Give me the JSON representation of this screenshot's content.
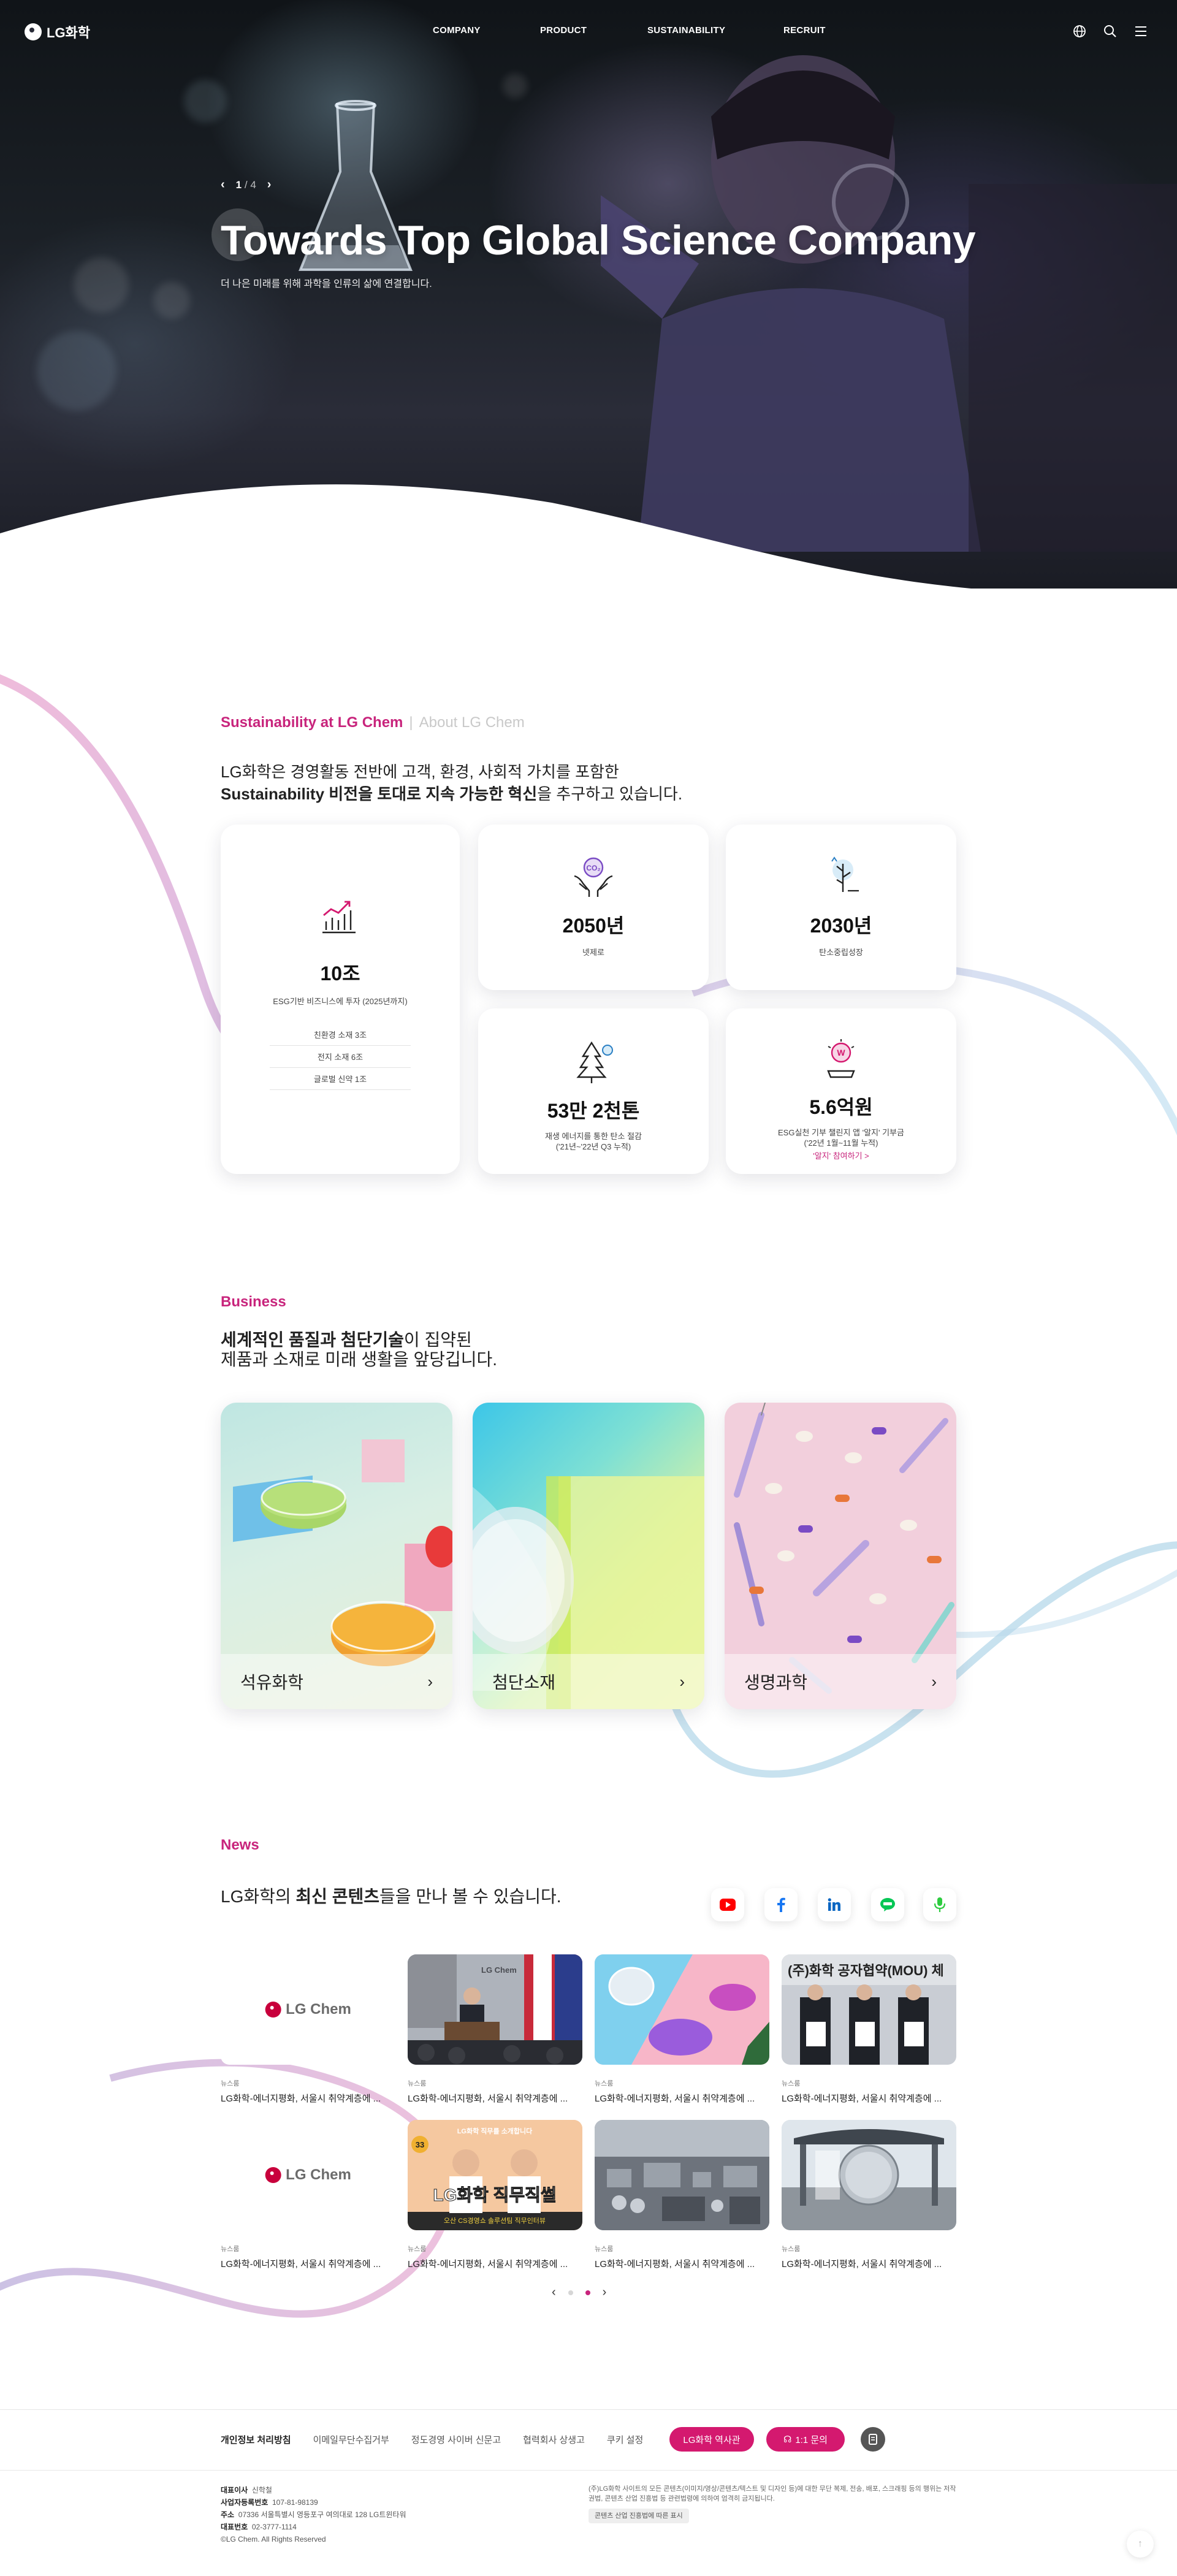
{
  "header": {
    "logo_text": "LG화학",
    "menu": [
      "COMPANY",
      "PRODUCT",
      "SUSTAINABILITY",
      "RECRUIT"
    ],
    "icons": [
      "globe-icon",
      "search-icon",
      "menu-icon"
    ]
  },
  "hero": {
    "pager_current": "1",
    "pager_total": "/ 4",
    "title": "Towards Top Global Science Company",
    "subtitle": "더 나은 미래를 위해 과학을 인류의 삶에 연결합니다."
  },
  "sustainability": {
    "eyebrow_active": "Sustainability at LG Chem",
    "eyebrow_inactive": "About LG Chem",
    "lead_line1": "LG화학은 경영활동 전반에 고객, 환경, 사회적 가치를 포함한",
    "lead_line2_bold": "Sustainability 비전을 토대로 지속 가능한 혁신",
    "lead_line2_rest": "을 추구하고 있습니다.",
    "cards": [
      {
        "icon": "growth-chart-icon",
        "num": "10조",
        "desc": "ESG기반 비즈니스에 투자 (2025년까지)",
        "list": [
          "친환경 소재 3조",
          "전지 소재 6조",
          "글로벌 신약 1조"
        ]
      },
      {
        "icon": "co2-hands-icon",
        "num": "2050년",
        "desc": "넷제로"
      },
      {
        "icon": "carbon-neutral-tree-icon",
        "num": "2030년",
        "desc": "탄소중립성장"
      },
      {
        "icon": "pine-tree-icon",
        "num": "53만 2천톤",
        "desc": "재생 에너지를 통한 탄소 절감",
        "desc2": "('21년~'22년 Q3 누적)"
      },
      {
        "icon": "donation-icon",
        "num": "5.6억원",
        "desc": "ESG실천 기부 챌린지 앱 '알지' 기부금",
        "desc2": "('22년 1월~11월 누적)",
        "link": "'알지' 참여하기 >"
      }
    ]
  },
  "business": {
    "eyebrow": "Business",
    "lead_bold": "세계적인 품질과 첨단기술",
    "lead_rest": "이 집약된",
    "lead_line2": "제품과 소재로 미래 생활을 앞당깁니다.",
    "cards": [
      {
        "label": "석유화학",
        "icon": "chevron-right-icon"
      },
      {
        "label": "첨단소재",
        "icon": "chevron-right-icon"
      },
      {
        "label": "생명과학",
        "icon": "chevron-right-icon"
      }
    ]
  },
  "news": {
    "eyebrow": "News",
    "lead_pre": "LG화학의 ",
    "lead_bold": "최신 콘텐츠",
    "lead_rest": "들을 만나 볼 수 있습니다.",
    "social": [
      {
        "name": "youtube-icon",
        "color": "#ff0000"
      },
      {
        "name": "facebook-icon",
        "color": "#1877f2"
      },
      {
        "name": "linkedin-icon",
        "color": "#0a66c2"
      },
      {
        "name": "line-icon",
        "color": "#06c755"
      },
      {
        "name": "podcast-icon",
        "color": "#2ecc40"
      }
    ],
    "logo_text": "LG Chem",
    "items": [
      {
        "cat": "뉴스룸",
        "title": "LG화학-에너지평화, 서울시 취약계층에 ..."
      },
      {
        "cat": "뉴스룸",
        "title": "LG화학-에너지평화, 서울시 취약계층에 ..."
      },
      {
        "cat": "뉴스룸",
        "title": "LG화학-에너지평화, 서울시 취약계층에 ..."
      },
      {
        "cat": "뉴스룸",
        "title": "LG화학-에너지평화, 서울시 취약계층에 ..."
      },
      {
        "cat": "뉴스룸",
        "title": "LG화학-에너지평화, 서울시 취약계층에 ..."
      },
      {
        "cat": "뉴스룸",
        "title": "LG화학-에너지평화, 서울시 취약계층에 ..."
      },
      {
        "cat": "뉴스룸",
        "title": "LG화학-에너지평화, 서울시 취약계층에 ..."
      },
      {
        "cat": "뉴스룸",
        "title": "LG화학-에너지평화, 서울시 취약계층에 ..."
      }
    ],
    "thumb_text_a": "(주)화학 공자협약(MOU) 체",
    "thumb_text_b": "LG화학 직무직썰",
    "thumb_text_c": "오산 CS경영쇼 솔루션팀 직무인터뷰",
    "thumb_badge": "33",
    "thumb_top": "LG화학 직무를 소개합니다",
    "thumb_logo": "LG Chem"
  },
  "footer": {
    "links": [
      "개인정보 처리방침",
      "이메일무단수집거부",
      "정도경영 사이버 신문고",
      "협력회사 상생고",
      "쿠키 설정"
    ],
    "museum_btn": "LG화학 역사관",
    "inquiry_btn": "1:1 문의",
    "info": [
      {
        "k": "대표이사",
        "v": "신학철"
      },
      {
        "k": "사업자등록번호",
        "v": "107-81-98139"
      },
      {
        "k": "주소",
        "v": "07336 서울특별시 영등포구 여의대로 128 LG트윈타워"
      },
      {
        "k": "대표번호",
        "v": "02-3777-1114"
      }
    ],
    "copyright": "©LG Chem. All Rights Reserved",
    "notice": "(주)LG화학 사이트의 모든 콘텐츠(이미지/영상/콘텐츠/텍스트 및 디자인 등)에 대한 무단 복제, 전송, 배포, 스크래핑 등의 행위는 저작권법, 콘텐츠 산업 진흥법 등 관련법령에 의하여 엄격히 금지됩니다.",
    "notice_btn": "콘텐츠 산업 진흥법에 따른 표시"
  }
}
